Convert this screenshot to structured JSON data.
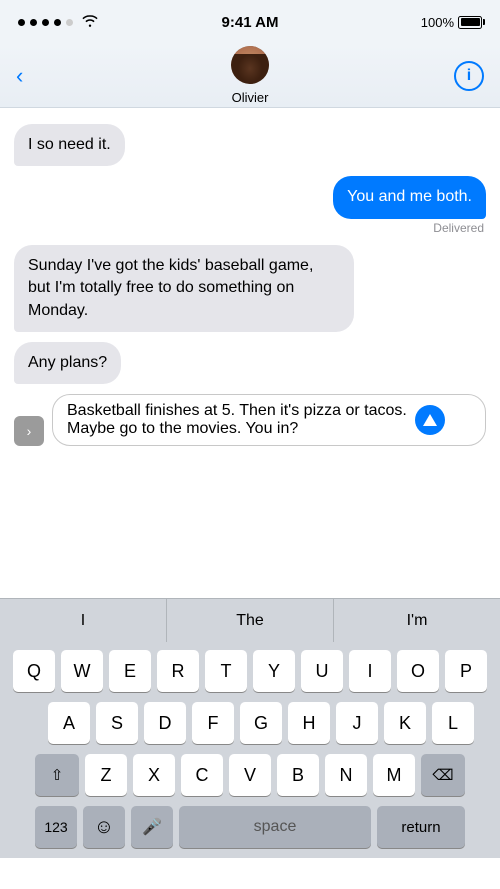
{
  "statusBar": {
    "time": "9:41 AM",
    "battery": "100%"
  },
  "navBar": {
    "backLabel": "",
    "contactName": "Olivier",
    "infoLabel": "i"
  },
  "messages": [
    {
      "id": 1,
      "type": "incoming",
      "text": "I so need it."
    },
    {
      "id": 2,
      "type": "outgoing",
      "text": "You and me both.",
      "status": "Delivered"
    },
    {
      "id": 3,
      "type": "incoming",
      "text": "Sunday I've got the kids' baseball game, but I'm totally free to do something on Monday."
    },
    {
      "id": 4,
      "type": "incoming",
      "text": "Any plans?"
    },
    {
      "id": 5,
      "type": "draft",
      "text": "Basketball finishes at 5. Then it's pizza or tacos. Maybe go to the movies. You in?"
    }
  ],
  "inputArea": {
    "expandIcon": "›",
    "sendIcon": "↑"
  },
  "predictive": {
    "items": [
      "I",
      "The",
      "I'm"
    ]
  },
  "keyboard": {
    "row1": [
      "Q",
      "W",
      "E",
      "R",
      "T",
      "Y",
      "U",
      "I",
      "O",
      "P"
    ],
    "row2": [
      "A",
      "S",
      "D",
      "F",
      "G",
      "H",
      "J",
      "K",
      "L"
    ],
    "row3": [
      "Z",
      "X",
      "C",
      "V",
      "B",
      "N",
      "M"
    ],
    "shiftIcon": "⇧",
    "deleteIcon": "⌫",
    "numLabel": "123",
    "emojiIcon": "☺",
    "micIcon": "🎤",
    "spaceLabel": "space",
    "returnLabel": "return"
  }
}
